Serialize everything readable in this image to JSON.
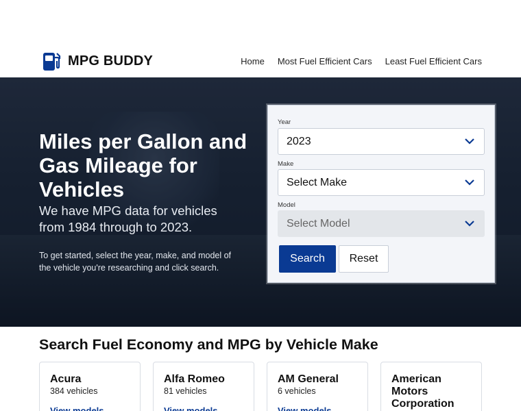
{
  "header": {
    "logo_text": "MPG BUDDY",
    "logo_icon": "fuel-pump-icon",
    "nav": [
      {
        "label": "Home"
      },
      {
        "label": "Most Fuel Efficient Cars"
      },
      {
        "label": "Least Fuel Efficient Cars"
      }
    ]
  },
  "hero": {
    "title": "Miles per Gallon and Gas Mileage for Vehicles",
    "subtitle": "We have MPG data for vehicles from 1984 through to 2023.",
    "hint": "To get started, select the year, make, and model of the vehicle you're researching and click search."
  },
  "search_form": {
    "year_label": "Year",
    "year_value": "2023",
    "make_label": "Make",
    "make_value": "Select Make",
    "model_label": "Model",
    "model_value": "Select Model",
    "search_button": "Search",
    "reset_button": "Reset"
  },
  "makes_section": {
    "title": "Search Fuel Economy and MPG by Vehicle Make",
    "cards": [
      {
        "name": "Acura",
        "count": "384 vehicles",
        "link": "View models"
      },
      {
        "name": "Alfa Romeo",
        "count": "81 vehicles",
        "link": "View models"
      },
      {
        "name": "AM General",
        "count": "6 vehicles",
        "link": "View models"
      },
      {
        "name": "American Motors Corporation",
        "count": "",
        "link": ""
      }
    ]
  },
  "colors": {
    "brand": "#0a3a93",
    "hero_bg": "#1e2735"
  }
}
